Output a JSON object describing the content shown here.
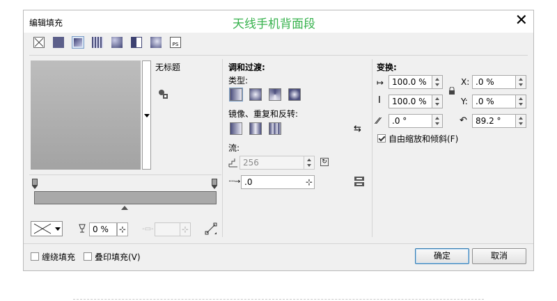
{
  "window": {
    "title": "编辑填充",
    "close_label": "✕"
  },
  "watermark": "天线手机背面段",
  "fill_types": [
    {
      "icon": "no-fill-icon"
    },
    {
      "icon": "uniform-fill-icon"
    },
    {
      "icon": "fountain-fill-icon",
      "selected": true
    },
    {
      "icon": "vector-pattern-icon"
    },
    {
      "icon": "bitmap-pattern-icon"
    },
    {
      "icon": "two-color-pattern-icon"
    },
    {
      "icon": "texture-fill-icon"
    },
    {
      "icon": "postscript-fill-icon",
      "text": "PS"
    }
  ],
  "preview": {
    "name_label": "无标题"
  },
  "blend": {
    "heading": "调和过渡:",
    "type_label": "类型:",
    "mirror_label": "镜像、重复和反转:",
    "flow_label": "流:",
    "steps_value": "256",
    "accel_value": ".0"
  },
  "transform": {
    "heading": "变换:",
    "width": "100.0 %",
    "height": "100.0 %",
    "x_label": "X:",
    "x_value": ".0 %",
    "y_label": "Y:",
    "y_value": ".0 %",
    "skew": ".0 °",
    "rotate": "89.2 °",
    "free_scale_label": "自由缩放和倾斜(F)",
    "free_scale_checked": true
  },
  "node": {
    "transparency": "0 %"
  },
  "footer": {
    "wrap_label": "缠绕填充",
    "overprint_label": "叠印填充(V)",
    "ok_label": "确定",
    "cancel_label": "取消"
  }
}
